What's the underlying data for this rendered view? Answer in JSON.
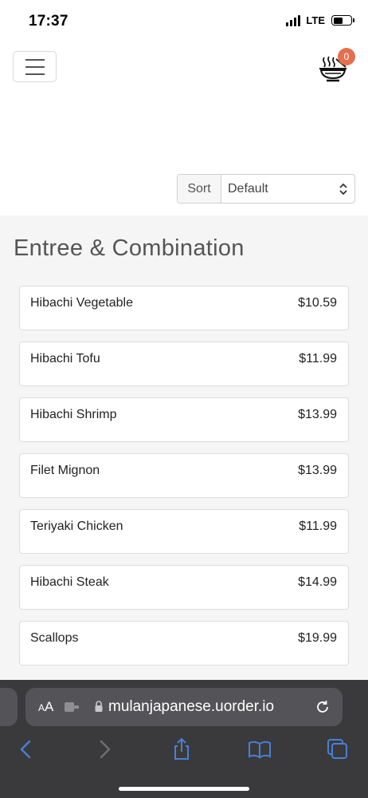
{
  "status_bar": {
    "time": "17:37",
    "network": "LTE"
  },
  "header": {
    "cart_count": "0"
  },
  "sort": {
    "label": "Sort",
    "selected": "Default"
  },
  "section": {
    "title": "Entree & Combination"
  },
  "items": [
    {
      "name": "Hibachi Vegetable",
      "price": "$10.59"
    },
    {
      "name": "Hibachi Tofu",
      "price": "$11.99"
    },
    {
      "name": "Hibachi Shrimp",
      "price": "$13.99"
    },
    {
      "name": "Filet Mignon",
      "price": "$13.99"
    },
    {
      "name": "Teriyaki Chicken",
      "price": "$11.99"
    },
    {
      "name": "Hibachi Steak",
      "price": "$14.99"
    },
    {
      "name": "Scallops",
      "price": "$19.99"
    }
  ],
  "browser": {
    "url": "mulanjapanese.uorder.io",
    "text_size_label_small": "A",
    "text_size_label_large": "A"
  },
  "colors": {
    "badge": "#e4704e",
    "browser_bar": "#3a3a3c",
    "url_pill": "#545458",
    "toolbar_icon": "#4a7fd6"
  }
}
